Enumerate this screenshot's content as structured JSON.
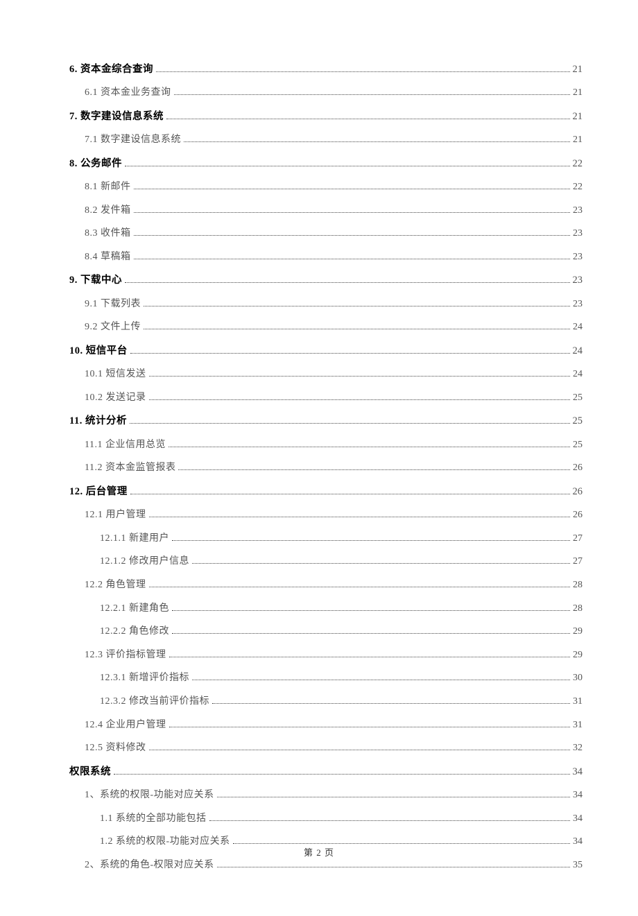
{
  "toc": [
    {
      "level": 1,
      "label": "6. 资本金综合查询",
      "page": "21"
    },
    {
      "level": 2,
      "label": "6.1 资本金业务查询",
      "page": "21"
    },
    {
      "level": 1,
      "label": "7. 数字建设信息系统",
      "page": "21"
    },
    {
      "level": 2,
      "label": "7.1 数字建设信息系统",
      "page": "21"
    },
    {
      "level": 1,
      "label": "8. 公务邮件",
      "page": "22"
    },
    {
      "level": 2,
      "label": "8.1 新邮件",
      "page": "22"
    },
    {
      "level": 2,
      "label": "8.2 发件箱",
      "page": "23"
    },
    {
      "level": 2,
      "label": "8.3 收件箱",
      "page": "23"
    },
    {
      "level": 2,
      "label": "8.4 草稿箱",
      "page": "23"
    },
    {
      "level": 1,
      "label": "9. 下载中心",
      "page": "23"
    },
    {
      "level": 2,
      "label": "9.1 下载列表",
      "page": "23"
    },
    {
      "level": 2,
      "label": "9.2 文件上传",
      "page": "24"
    },
    {
      "level": 1,
      "label": "10. 短信平台",
      "page": "24"
    },
    {
      "level": 2,
      "label": "10.1 短信发送",
      "page": "24"
    },
    {
      "level": 2,
      "label": "10.2 发送记录",
      "page": "25"
    },
    {
      "level": 1,
      "label": "11. 统计分析",
      "page": "25"
    },
    {
      "level": 2,
      "label": "11.1 企业信用总览",
      "page": "25"
    },
    {
      "level": 2,
      "label": "11.2 资本金监管报表",
      "page": "26"
    },
    {
      "level": 1,
      "label": "12. 后台管理",
      "page": "26"
    },
    {
      "level": 2,
      "label": "12.1 用户管理",
      "page": "26"
    },
    {
      "level": 3,
      "label": "12.1.1 新建用户",
      "page": "27"
    },
    {
      "level": 3,
      "label": "12.1.2 修改用户信息",
      "page": "27"
    },
    {
      "level": 2,
      "label": "12.2 角色管理",
      "page": "28"
    },
    {
      "level": 3,
      "label": "12.2.1 新建角色",
      "page": "28"
    },
    {
      "level": 3,
      "label": "12.2.2 角色修改",
      "page": "29"
    },
    {
      "level": 2,
      "label": "12.3 评价指标管理",
      "page": "29"
    },
    {
      "level": 3,
      "label": "12.3.1 新增评价指标",
      "page": "30"
    },
    {
      "level": 3,
      "label": "12.3.2 修改当前评价指标",
      "page": "31"
    },
    {
      "level": 2,
      "label": "12.4 企业用户管理",
      "page": "31"
    },
    {
      "level": 2,
      "label": "12.5 资料修改",
      "page": "32"
    },
    {
      "level": 1,
      "label": "权限系统",
      "page": "34"
    },
    {
      "level": 2,
      "label": "1、系统的权限-功能对应关系",
      "page": "34"
    },
    {
      "level": 3,
      "label": "1.1 系统的全部功能包括",
      "page": "34"
    },
    {
      "level": 3,
      "label": "1.2 系统的权限-功能对应关系",
      "page": "34"
    },
    {
      "level": 2,
      "label": "2、系统的角色-权限对应关系",
      "page": "35"
    }
  ],
  "footer": "第 2 页"
}
